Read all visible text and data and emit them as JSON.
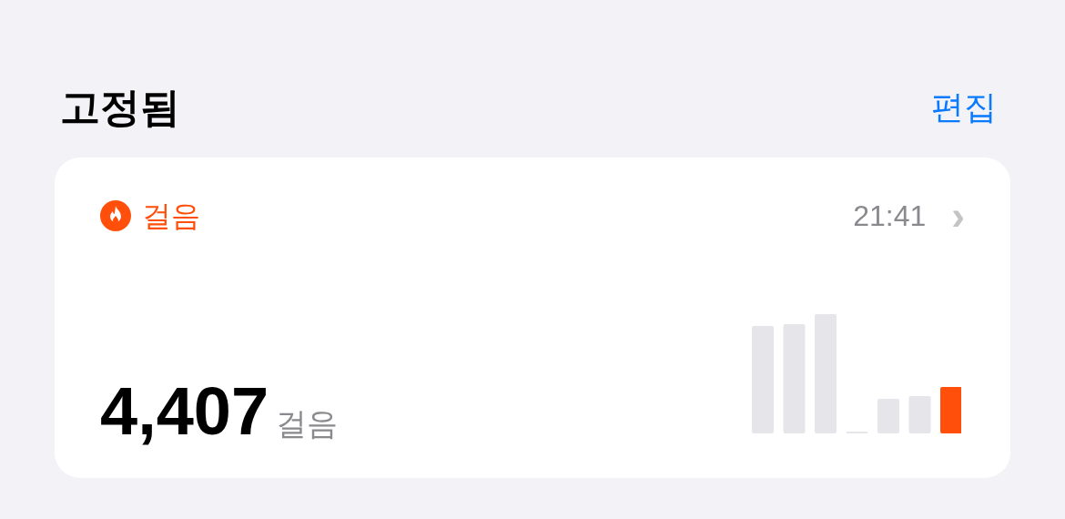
{
  "section": {
    "title": "고정됨",
    "action": "편집"
  },
  "card": {
    "label": "걸음",
    "time": "21:41",
    "chevron": "›",
    "value": "4,407",
    "unit": "걸음"
  }
}
